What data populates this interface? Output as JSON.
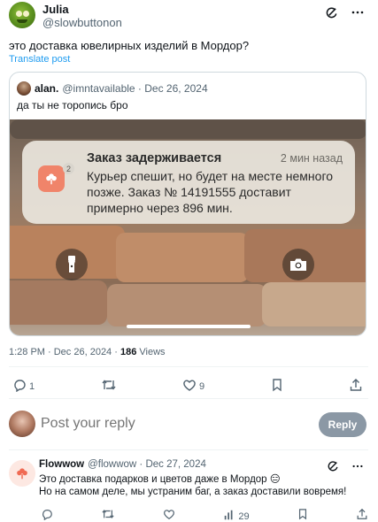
{
  "tweet": {
    "author_name": "Julia",
    "author_handle": "@slowbuttonon",
    "text": "это доставка ювелирных изделий в Мордор?",
    "translate_label": "Translate post",
    "time": "1:28 PM · Dec 26, 2024 ·",
    "views_count": "186",
    "views_label": "Views"
  },
  "quote": {
    "author_name": "alan.",
    "author_meta": "@imntavailable · Dec 26, 2024",
    "text": "да ты не торопись бро",
    "notification": {
      "title": "Заказ задерживается",
      "time": "2 мин назад",
      "body": "Курьер спешит, но будет на месте немного позже. Заказ № 14191555 доставит примерно через 896 мин.",
      "badge": "2"
    }
  },
  "actions": {
    "replies": "1",
    "retweets": "",
    "likes": "9"
  },
  "composer": {
    "placeholder": "Post your reply",
    "button_label": "Reply"
  },
  "reply": {
    "author_name": "Flowwow",
    "author_meta": "@flowwow · Dec 27, 2024",
    "line1": "Это доставка подарков и цветов даже в Мордор 😑",
    "line2": "Но на самом деле, мы устраним баг, а заказ доставили вовремя!",
    "views": "29"
  },
  "colors": {
    "link": "#1d9bf0",
    "muted": "#536471",
    "reply_button": "#8b98a5",
    "app_icon": "#f0846a"
  },
  "icons": [
    "grok-icon",
    "more-icon",
    "reply-icon",
    "retweet-icon",
    "like-icon",
    "bookmark-icon",
    "share-icon",
    "flashlight-icon",
    "camera-icon",
    "flower-icon",
    "views-icon"
  ]
}
